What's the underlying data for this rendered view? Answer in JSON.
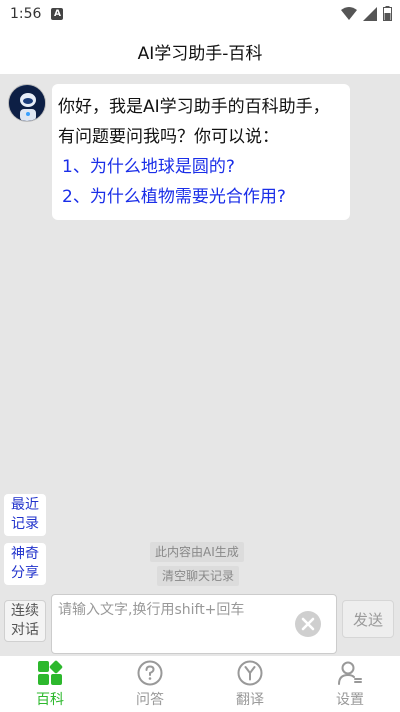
{
  "status_bar": {
    "time": "1:56",
    "notif_letter": "A"
  },
  "header": {
    "title": "AI学习助手-百科"
  },
  "chat": {
    "bot_message_line1": "你好，我是AI学习助手的百科助手，有问题要问我吗？你可以说：",
    "suggestions": [
      "1、为什么地球是圆的?",
      "2、为什么植物需要光合作用?"
    ],
    "ai_note": "此内容由AI生成",
    "clear_label": "清空聊天记录"
  },
  "side_buttons": {
    "recent": "最近记录",
    "share": "神奇分享"
  },
  "input_bar": {
    "continuous_label": "连续对话",
    "placeholder": "请输入文字,换行用shift+回车",
    "send_label": "发送"
  },
  "bottom_nav": {
    "items": [
      {
        "label": "百科",
        "icon": "grid-icon",
        "active": true
      },
      {
        "label": "问答",
        "icon": "question-icon",
        "active": false
      },
      {
        "label": "翻译",
        "icon": "y-circle-icon",
        "active": false
      },
      {
        "label": "设置",
        "icon": "user-settings-icon",
        "active": false
      }
    ]
  },
  "colors": {
    "accent": "#2db82d",
    "link": "#1a2ee8",
    "side_text": "#2233cc"
  }
}
